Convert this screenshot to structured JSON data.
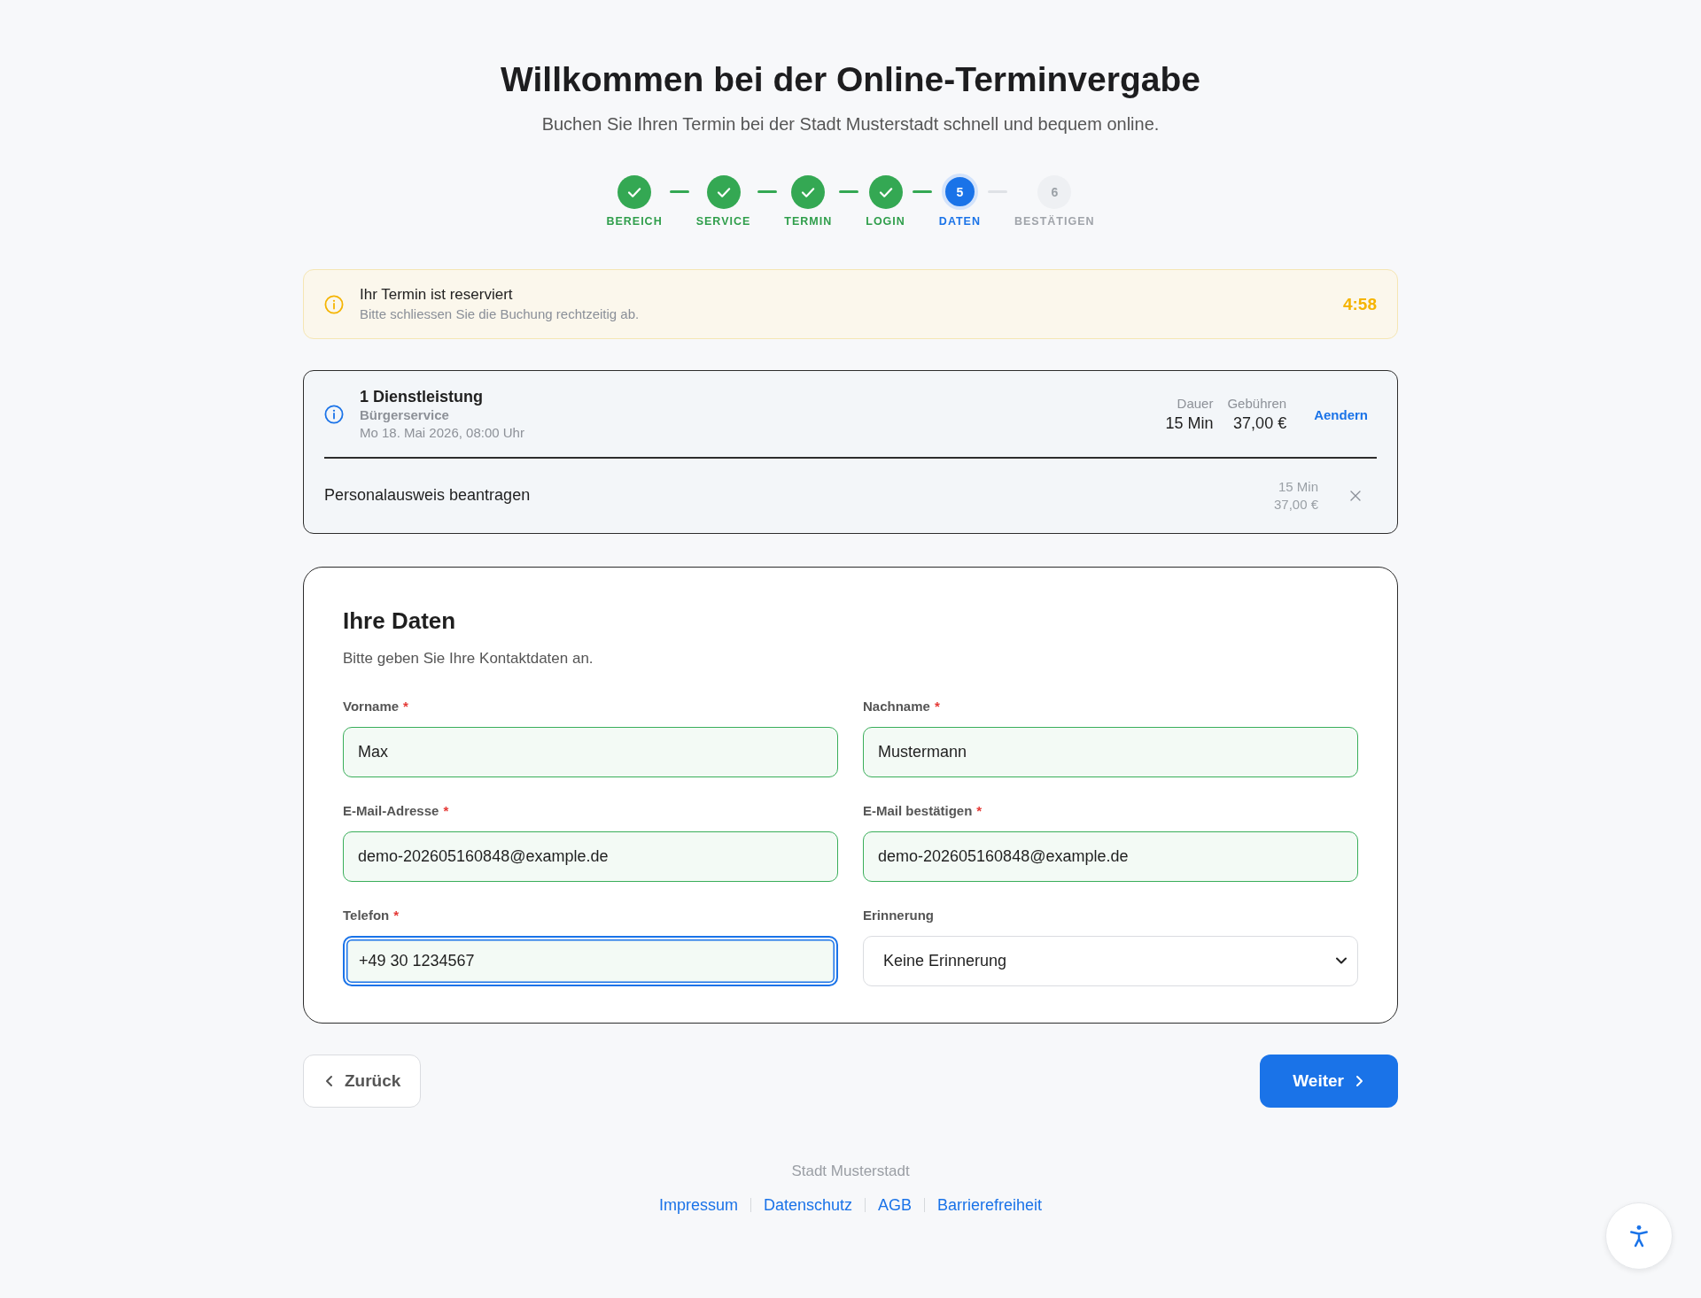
{
  "header": {
    "title": "Willkommen bei der Online-Terminvergabe",
    "subtitle": "Buchen Sie Ihren Termin bei der Stadt Musterstadt schnell und bequem online."
  },
  "stepper": {
    "steps": [
      {
        "label": "BEREICH",
        "completed": true,
        "current": false
      },
      {
        "label": "SERVICE",
        "completed": true,
        "current": false
      },
      {
        "label": "TERMIN",
        "completed": true,
        "current": false
      },
      {
        "label": "LOGIN",
        "completed": true,
        "current": false
      },
      {
        "label": "DATEN",
        "completed": false,
        "current": true,
        "number": "5"
      },
      {
        "label": "BESTÄTIGEN",
        "completed": false,
        "current": false,
        "number": "6"
      }
    ]
  },
  "reservation_notice": {
    "title": "Ihr Termin ist reserviert",
    "text": "Bitte schliessen Sie die Buchung rechtzeitig ab.",
    "timer": "4:58"
  },
  "service_summary": {
    "title": "1 Dienstleistung",
    "category": "Bürgerservice",
    "datetime": "Mo 18. Mai 2026, 08:00 Uhr",
    "totals": [
      {
        "label": "Dauer",
        "value": "15 Min"
      },
      {
        "label": "Gebühren",
        "value": "37,00 €"
      }
    ],
    "change_link": "Aendern",
    "items": [
      {
        "name": "Personalausweis beantragen",
        "duration": "15 Min",
        "fee": "37,00 €"
      }
    ]
  },
  "form": {
    "title": "Ihre Daten",
    "intro": "Bitte geben Sie Ihre Kontaktdaten an.",
    "fields": [
      {
        "label": "Vorname",
        "required_mark": "*",
        "kind": "input",
        "value": "Max",
        "valid": true,
        "focused": false
      },
      {
        "label": "Nachname",
        "required_mark": "*",
        "kind": "input",
        "value": "Mustermann",
        "valid": true,
        "focused": false
      },
      {
        "label": "E-Mail-Adresse",
        "required_mark": "*",
        "kind": "input",
        "value": "demo-202605160848@example.de",
        "valid": true,
        "focused": false
      },
      {
        "label": "E-Mail bestätigen",
        "required_mark": "*",
        "kind": "input",
        "value": "demo-202605160848@example.de",
        "valid": true,
        "focused": false
      },
      {
        "label": "Telefon",
        "required_mark": "*",
        "kind": "input",
        "value": "+49 30 1234567",
        "valid": true,
        "focused": true
      },
      {
        "label": "Erinnerung",
        "kind": "select",
        "value": "Keine Erinnerung",
        "valid": false,
        "focused": false
      }
    ]
  },
  "navigation": {
    "back": "Zurück",
    "next": "Weiter"
  },
  "footer": {
    "organization": "Stadt Musterstadt",
    "links": [
      "Impressum",
      "Datenschutz",
      "AGB",
      "Barrierefreiheit"
    ]
  }
}
